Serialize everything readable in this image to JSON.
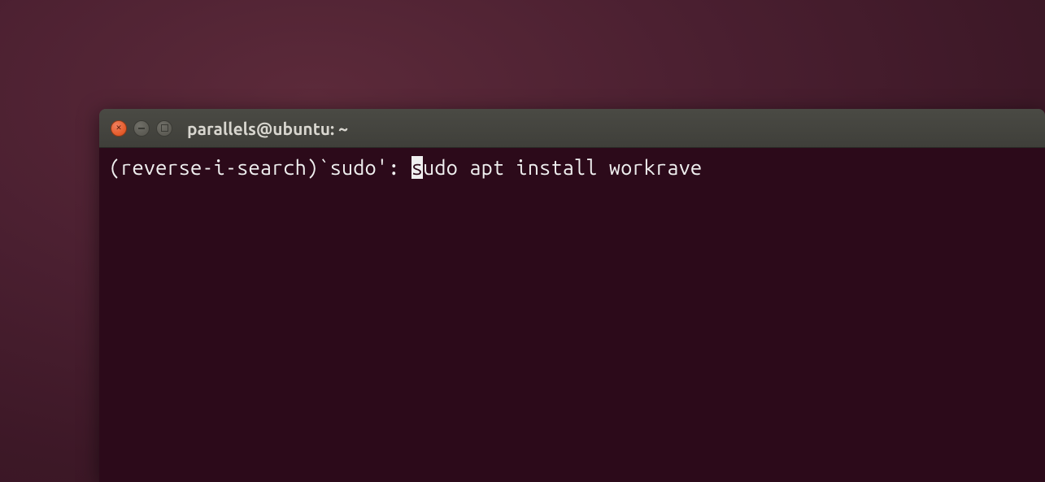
{
  "window": {
    "title": "parallels@ubuntu: ~"
  },
  "terminal": {
    "search_prefix": "(reverse-i-search)`",
    "search_term": "sudo",
    "search_suffix": "': ",
    "cursor_char": "s",
    "command_rest": "udo apt install workrave"
  }
}
